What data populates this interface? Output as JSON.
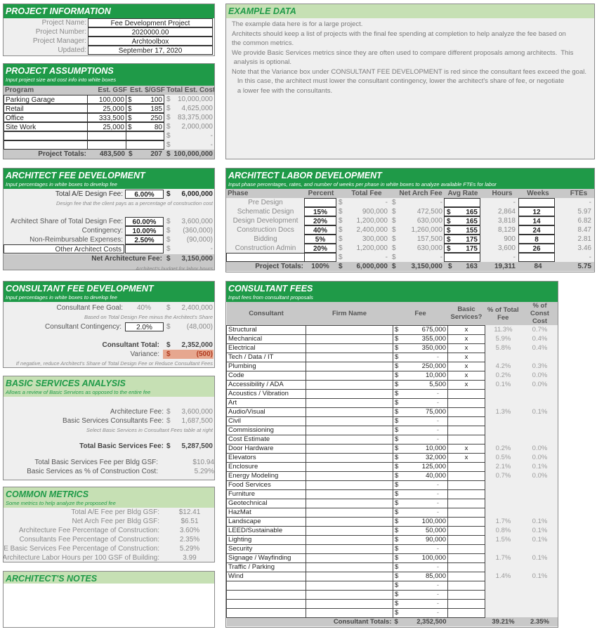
{
  "project_info": {
    "title": "PROJECT INFORMATION",
    "fields": [
      {
        "label": "Project Name:",
        "value": "Fee Development Project"
      },
      {
        "label": "Project Number:",
        "value": "2020000.00"
      },
      {
        "label": "Project Manager:",
        "value": "Archtoolbox"
      },
      {
        "label": "Updated:",
        "value": "September 17, 2020"
      }
    ]
  },
  "example_data": {
    "title": "EXAMPLE DATA",
    "lines": [
      "The example data here is for a large project.",
      "Architects should keep a list of projects with the final fee spending at completion to help analyze the fee based on",
      "the common metrics.",
      "We provide Basic Services metrics since they are often used to compare different proposals among architects.  This",
      " analysis is optional.",
      "Note that the Variance box under CONSULTANT FEE DEVELOPMENT is red since the consultant fees exceed the goal.",
      "   In this case, the architect must lower the consultant contingency, lower the architect's share of fee, or negotiate",
      "   a lower fee with the consultants."
    ]
  },
  "project_assumptions": {
    "title": "PROJECT ASSUMPTIONS",
    "subtitle": "Input project size and cost info into white boxes",
    "headers": [
      "Program",
      "Est. GSF",
      "Est. $/GSF",
      "Total Est. Cost"
    ],
    "rows": [
      {
        "program": "Parking Garage",
        "gsf": "100,000",
        "cur": "$",
        "per": "100",
        "cur2": "$",
        "total": "10,000,000"
      },
      {
        "program": "Retail",
        "gsf": "25,000",
        "cur": "$",
        "per": "185",
        "cur2": "$",
        "total": "4,625,000"
      },
      {
        "program": "Office",
        "gsf": "333,500",
        "cur": "$",
        "per": "250",
        "cur2": "$",
        "total": "83,375,000"
      },
      {
        "program": "Site Work",
        "gsf": "25,000",
        "cur": "$",
        "per": "80",
        "cur2": "$",
        "total": "2,000,000"
      },
      {
        "program": "",
        "gsf": "",
        "cur": "",
        "per": "",
        "cur2": "$",
        "total": "-"
      },
      {
        "program": "",
        "gsf": "",
        "cur": "",
        "per": "",
        "cur2": "$",
        "total": "-"
      }
    ],
    "totals": {
      "label": "Project Totals:",
      "gsf": "483,500",
      "cur": "$",
      "per": "207",
      "cur2": "$",
      "total": "100,000,000"
    }
  },
  "architect_fee": {
    "title": "ARCHITECT FEE DEVELOPMENT",
    "subtitle": "Input percentages in white boxes to develop fee",
    "total_ae": {
      "label": "Total A/E Design Fee:",
      "pct": "6.00%",
      "cur": "$",
      "amount": "6,000,000"
    },
    "total_ae_note": "Design fee that the client pays as a percentage of construction cost",
    "rows": [
      {
        "label": "Architect Share of Total Design Fee:",
        "pct": "60.00%",
        "cur": "$",
        "amount": "3,600,000"
      },
      {
        "label": "Contingency:",
        "pct": "10.00%",
        "cur": "$",
        "amount": "(360,000)"
      },
      {
        "label": "Non-Reimbursable Expenses:",
        "pct": "2.50%",
        "cur": "$",
        "amount": "(90,000)"
      },
      {
        "label": "Other Architect Costs",
        "pct": "",
        "cur": "$",
        "amount": "-"
      }
    ],
    "net": {
      "label": "Net Architecture Fee:",
      "cur": "$",
      "amount": "3,150,000"
    },
    "net_note": "Architect's budget for labor hours"
  },
  "labor": {
    "title": "ARCHITECT LABOR DEVELOPMENT",
    "subtitle": "Input phase percentages, rates, and number of weeks per phase in white boxes to analyze available FTEs for labor",
    "headers": [
      "Phase",
      "Percent",
      "Total Fee",
      "Net Arch Fee",
      "Avg Rate",
      "Hours",
      "Weeks",
      "FTEs"
    ],
    "rows": [
      {
        "phase": "Pre Design",
        "pct": "",
        "fee": "-",
        "net": "-",
        "rate_cur": "",
        "rate": "",
        "hours": "-",
        "weeks": "",
        "ftes": "-"
      },
      {
        "phase": "Schematic Design",
        "pct": "15%",
        "fee": "900,000",
        "net": "472,500",
        "rate_cur": "$",
        "rate": "165",
        "hours": "2,864",
        "weeks": "12",
        "ftes": "5.97"
      },
      {
        "phase": "Design Development",
        "pct": "20%",
        "fee": "1,200,000",
        "net": "630,000",
        "rate_cur": "$",
        "rate": "165",
        "hours": "3,818",
        "weeks": "14",
        "ftes": "6.82"
      },
      {
        "phase": "Construction Docs",
        "pct": "40%",
        "fee": "2,400,000",
        "net": "1,260,000",
        "rate_cur": "$",
        "rate": "155",
        "hours": "8,129",
        "weeks": "24",
        "ftes": "8.47"
      },
      {
        "phase": "Bidding",
        "pct": "5%",
        "fee": "300,000",
        "net": "157,500",
        "rate_cur": "$",
        "rate": "175",
        "hours": "900",
        "weeks": "8",
        "ftes": "2.81"
      },
      {
        "phase": "Construction Admin",
        "pct": "20%",
        "fee": "1,200,000",
        "net": "630,000",
        "rate_cur": "$",
        "rate": "175",
        "hours": "3,600",
        "weeks": "26",
        "ftes": "3.46"
      },
      {
        "phase": "",
        "pct": "",
        "fee": "-",
        "net": "-",
        "rate_cur": "",
        "rate": "",
        "hours": "-",
        "weeks": "",
        "ftes": "-"
      }
    ],
    "totals": {
      "label": "Project Totals:",
      "pct": "100%",
      "fee": "6,000,000",
      "net": "3,150,000",
      "rate_cur": "$",
      "rate": "163",
      "hours": "19,311",
      "weeks": "84",
      "ftes": "5.75"
    },
    "currency": "$"
  },
  "consultant_fee_dev": {
    "title": "CONSULTANT FEE DEVELOPMENT",
    "subtitle": "Input percentages in white boxes to develop fee",
    "goal": {
      "label": "Consultant Fee Goal:",
      "pct": "40%",
      "cur": "$",
      "amount": "2,400,000"
    },
    "goal_note": "Based on Total Design Fee minus the Architect's Share",
    "contingency": {
      "label": "Consultant Contingency:",
      "pct": "2.0%",
      "cur": "$",
      "amount": "(48,000)"
    },
    "total": {
      "label": "Consultant Total:",
      "cur": "$",
      "amount": "2,352,000"
    },
    "variance": {
      "label": "Variance:",
      "cur": "$",
      "amount": "(500)",
      "color": "#e6a78f"
    },
    "variance_note": "If negative, reduce Architect's Share of Total Design Fee or Reduce Consultant Fees"
  },
  "basic_services": {
    "title": "BASIC SERVICES ANALYSIS",
    "subtitle": "Allows a review of Basic Services as opposed to the entire fee",
    "arch_fee": {
      "label": "Architecture Fee:",
      "cur": "$",
      "amount": "3,600,000"
    },
    "cons_fee": {
      "label": "Basic Services Consultants Fee:",
      "cur": "$",
      "amount": "1,687,500"
    },
    "note": "Select Basic Services in Consultant Fees table at right",
    "total": {
      "label": "Total Basic Services Fee:",
      "cur": "$",
      "amount": "5,287,500"
    },
    "per_gsf": {
      "label": "Total Basic Services Fee per Bldg GSF:",
      "value": "$10.94"
    },
    "pct_const": {
      "label": "Basic Services as % of Construction Cost:",
      "value": "5.29%"
    }
  },
  "common_metrics": {
    "title": "COMMON METRICS",
    "subtitle": "Some metrics to help analyze the proposed fee",
    "rows": [
      {
        "label": "Total A/E Fee per Bldg GSF:",
        "value": "$12.41"
      },
      {
        "label": "Net Arch Fee per Bldg GSF:",
        "value": "$6.51"
      },
      {
        "label": "Architecture Fee Percentage of Construction:",
        "value": "3.60%"
      },
      {
        "label": "Consultants Fee Percentage of Construction:",
        "value": "2.35%"
      },
      {
        "label": "Total A/E Basic Services Fee Percentage of Construction:",
        "value": "5.29%"
      },
      {
        "label": "Architecture Labor Hours per 100 GSF of Building:",
        "value": "3.99"
      }
    ]
  },
  "notes": {
    "title": "ARCHITECT'S NOTES",
    "content": ""
  },
  "consultant_fees": {
    "title": "CONSULTANT FEES",
    "subtitle": "Input fees from consultant proposals",
    "headers": {
      "consultant": "Consultant",
      "firm": "Firm Name",
      "fee": "Fee",
      "basic": "Basic Services?",
      "pct_fee": "% of Total Fee",
      "pct_const": "% of Const Cost"
    },
    "currency": "$",
    "rows": [
      {
        "name": "Structural",
        "firm": "",
        "fee": "675,000",
        "basic": "x",
        "pct_fee": "11.3%",
        "pct_const": "0.7%"
      },
      {
        "name": "Mechanical",
        "firm": "",
        "fee": "355,000",
        "basic": "x",
        "pct_fee": "5.9%",
        "pct_const": "0.4%"
      },
      {
        "name": "Electrical",
        "firm": "",
        "fee": "350,000",
        "basic": "x",
        "pct_fee": "5.8%",
        "pct_const": "0.4%"
      },
      {
        "name": "Tech / Data / IT",
        "firm": "",
        "fee": "-",
        "basic": "x",
        "pct_fee": "",
        "pct_const": ""
      },
      {
        "name": "Plumbing",
        "firm": "",
        "fee": "250,000",
        "basic": "x",
        "pct_fee": "4.2%",
        "pct_const": "0.3%"
      },
      {
        "name": "Code",
        "firm": "",
        "fee": "10,000",
        "basic": "x",
        "pct_fee": "0.2%",
        "pct_const": "0.0%"
      },
      {
        "name": "Accessibility / ADA",
        "firm": "",
        "fee": "5,500",
        "basic": "x",
        "pct_fee": "0.1%",
        "pct_const": "0.0%"
      },
      {
        "name": "Acoustics / Vibration",
        "firm": "",
        "fee": "-",
        "basic": "",
        "pct_fee": "",
        "pct_const": ""
      },
      {
        "name": "Art",
        "firm": "",
        "fee": "-",
        "basic": "",
        "pct_fee": "",
        "pct_const": ""
      },
      {
        "name": "Audio/Visual",
        "firm": "",
        "fee": "75,000",
        "basic": "",
        "pct_fee": "1.3%",
        "pct_const": "0.1%"
      },
      {
        "name": "Civil",
        "firm": "",
        "fee": "-",
        "basic": "",
        "pct_fee": "",
        "pct_const": ""
      },
      {
        "name": "Commissioning",
        "firm": "",
        "fee": "-",
        "basic": "",
        "pct_fee": "",
        "pct_const": ""
      },
      {
        "name": "Cost Estimate",
        "firm": "",
        "fee": "-",
        "basic": "",
        "pct_fee": "",
        "pct_const": ""
      },
      {
        "name": "Door Hardware",
        "firm": "",
        "fee": "10,000",
        "basic": "x",
        "pct_fee": "0.2%",
        "pct_const": "0.0%"
      },
      {
        "name": "Elevators",
        "firm": "",
        "fee": "32,000",
        "basic": "x",
        "pct_fee": "0.5%",
        "pct_const": "0.0%"
      },
      {
        "name": "Enclosure",
        "firm": "",
        "fee": "125,000",
        "basic": "",
        "pct_fee": "2.1%",
        "pct_const": "0.1%"
      },
      {
        "name": "Energy Modeling",
        "firm": "",
        "fee": "40,000",
        "basic": "",
        "pct_fee": "0.7%",
        "pct_const": "0.0%"
      },
      {
        "name": "Food Services",
        "firm": "",
        "fee": "-",
        "basic": "",
        "pct_fee": "",
        "pct_const": ""
      },
      {
        "name": "Furniture",
        "firm": "",
        "fee": "-",
        "basic": "",
        "pct_fee": "",
        "pct_const": ""
      },
      {
        "name": "Geotechnical",
        "firm": "",
        "fee": "-",
        "basic": "",
        "pct_fee": "",
        "pct_const": ""
      },
      {
        "name": "HazMat",
        "firm": "",
        "fee": "-",
        "basic": "",
        "pct_fee": "",
        "pct_const": ""
      },
      {
        "name": "Landscape",
        "firm": "",
        "fee": "100,000",
        "basic": "",
        "pct_fee": "1.7%",
        "pct_const": "0.1%"
      },
      {
        "name": "LEED/Sustainable",
        "firm": "",
        "fee": "50,000",
        "basic": "",
        "pct_fee": "0.8%",
        "pct_const": "0.1%"
      },
      {
        "name": "Lighting",
        "firm": "",
        "fee": "90,000",
        "basic": "",
        "pct_fee": "1.5%",
        "pct_const": "0.1%"
      },
      {
        "name": "Security",
        "firm": "",
        "fee": "-",
        "basic": "",
        "pct_fee": "",
        "pct_const": ""
      },
      {
        "name": "Signage / Wayfinding",
        "firm": "",
        "fee": "100,000",
        "basic": "",
        "pct_fee": "1.7%",
        "pct_const": "0.1%"
      },
      {
        "name": "Traffic / Parking",
        "firm": "",
        "fee": "-",
        "basic": "",
        "pct_fee": "",
        "pct_const": ""
      },
      {
        "name": "Wind",
        "firm": "",
        "fee": "85,000",
        "basic": "",
        "pct_fee": "1.4%",
        "pct_const": "0.1%"
      },
      {
        "name": "",
        "firm": "",
        "fee": "-",
        "basic": "",
        "pct_fee": "",
        "pct_const": ""
      },
      {
        "name": "",
        "firm": "",
        "fee": "-",
        "basic": "",
        "pct_fee": "",
        "pct_const": ""
      },
      {
        "name": "",
        "firm": "",
        "fee": "-",
        "basic": "",
        "pct_fee": "",
        "pct_const": ""
      },
      {
        "name": "",
        "firm": "",
        "fee": "-",
        "basic": "",
        "pct_fee": "",
        "pct_const": ""
      }
    ],
    "totals": {
      "label": "Consultant Totals:",
      "cur": "$",
      "fee": "2,352,500",
      "pct_fee": "39.21%",
      "pct_const": "2.35%"
    }
  },
  "theme": {
    "green_dark": "#1f9a48",
    "green_light": "#c6e0b4",
    "panel_bg": "#efefef",
    "variance_red": "#e6a78f"
  }
}
